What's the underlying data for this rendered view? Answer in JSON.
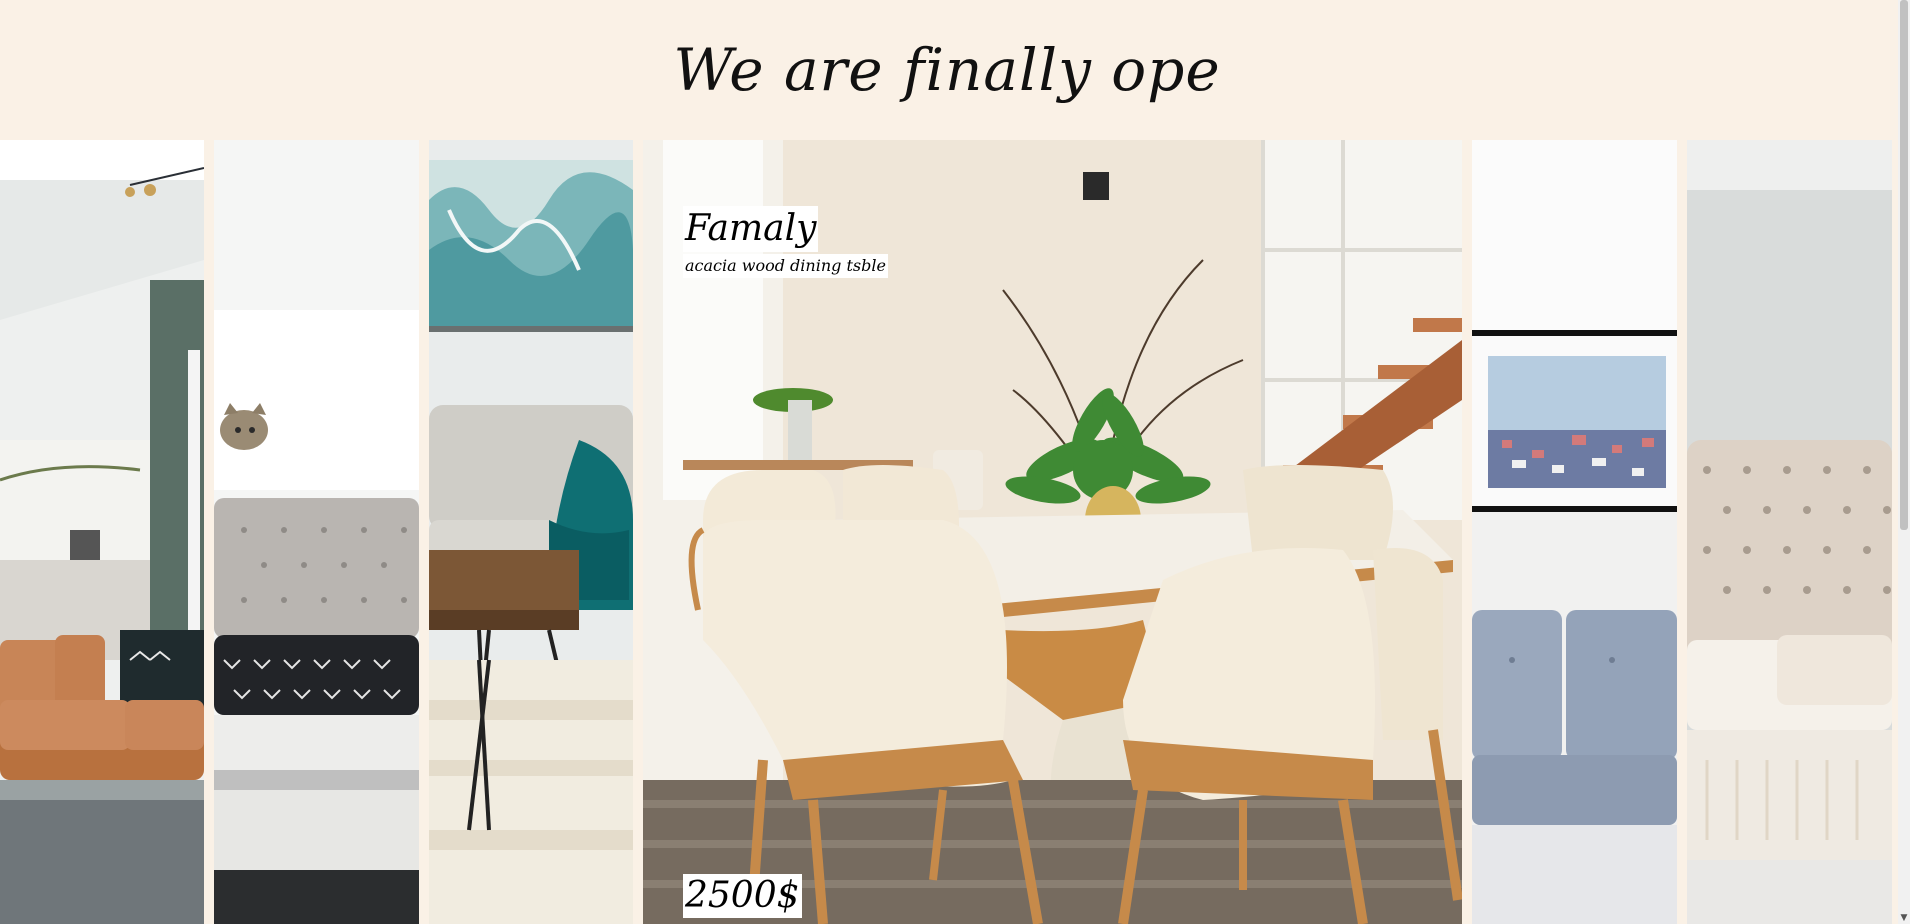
{
  "header": {
    "headline": "We are finally ope"
  },
  "featured": {
    "title": "Famaly",
    "subtitle": "acacia wood dining tsble",
    "price": "2500$"
  },
  "panels": [
    {
      "name": "living-room-leather-sofa-photo"
    },
    {
      "name": "bedroom-cat-headboard-photo"
    },
    {
      "name": "living-room-coffee-table-photo"
    },
    {
      "name": "dining-room-table-photo"
    },
    {
      "name": "blue-sofa-framed-print-photo"
    },
    {
      "name": "tufted-bed-headboard-photo"
    }
  ],
  "colors": {
    "background": "#faf1e6",
    "text": "#111111",
    "caption_bg": "#ffffff"
  }
}
